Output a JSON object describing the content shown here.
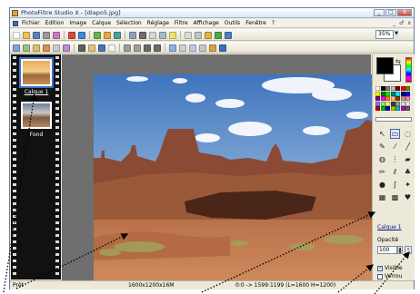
{
  "window": {
    "title": "PhotoFiltre Studio X - [diapo5.jpg]",
    "controls": [
      "_",
      "□",
      "X"
    ]
  },
  "menubar": {
    "items": [
      "Fichier",
      "Edition",
      "Image",
      "Calque",
      "Sélection",
      "Réglage",
      "Filtre",
      "Affichage",
      "Outils",
      "Fenêtre",
      "?"
    ],
    "mdi_controls": [
      "_",
      "♂",
      "x"
    ]
  },
  "toolbar": {
    "zoom": "35%"
  },
  "filmstrip": {
    "layers": [
      {
        "label": "Calque 1",
        "selected": true
      },
      {
        "label": "Fond",
        "selected": false
      }
    ]
  },
  "right_panel": {
    "foreground_color": "#000000",
    "background_color": "#ffffff",
    "palette": [
      "#ffffff",
      "#000000",
      "#808080",
      "#c0c0c0",
      "#800000",
      "#ff0000",
      "#808000",
      "#ffff00",
      "#008000",
      "#00ff00",
      "#008080",
      "#00ffff",
      "#000080",
      "#0000ff",
      "#800080",
      "#ff00ff",
      "#ff8000",
      "#ffc080",
      "#804000",
      "#c0a080",
      "#ff80c0",
      "#8080ff",
      "#80ff80",
      "#ffff80",
      "#404040",
      "#a0a0a0",
      "#e0e0e0",
      "#f0f0f0",
      "#c00000",
      "#00c000",
      "#0000c0",
      "#c0c000",
      "#00c0c0",
      "#c000c0",
      "#606060"
    ],
    "tools": [
      "selection-arrow",
      "rectangle-select",
      "lasso",
      "eyedropper",
      "wand",
      "line",
      "fill-bucket",
      "spray",
      "eraser",
      "pencil",
      "brush",
      "stamp",
      "blur",
      "smudge",
      "dropper",
      "clone",
      "mosaic",
      "hand"
    ],
    "layer_name": "Calque 1",
    "opacity_label": "Opacité",
    "opacity_value": "100",
    "visible_label": "Visible",
    "visible_checked": true,
    "lock_label": "Verrou",
    "lock_checked": false
  },
  "statusbar": {
    "state": "Prêt",
    "dimensions": "1600x1200x16M",
    "coords": "0:0 -> 1599:1199 (L=1600  H=1200)"
  }
}
